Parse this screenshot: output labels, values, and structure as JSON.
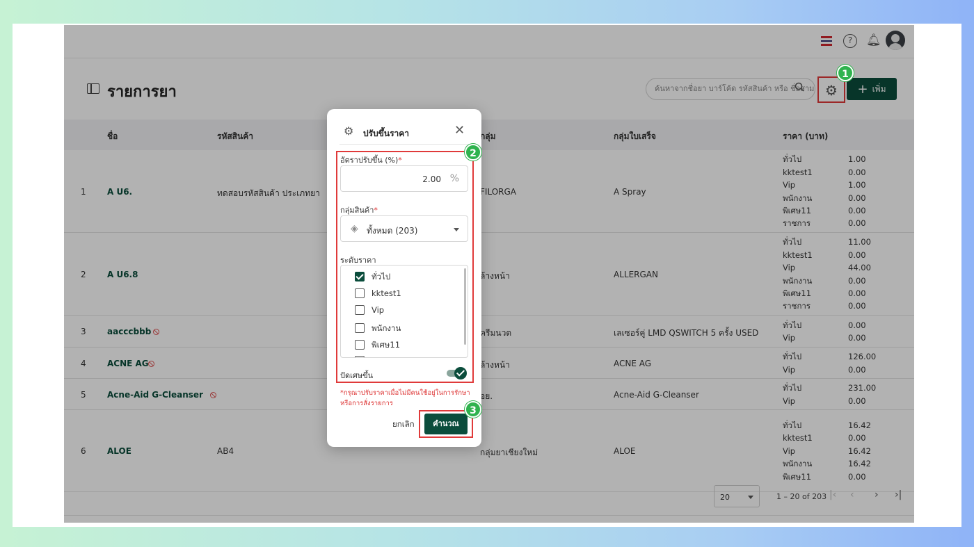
{
  "page": {
    "title": "รายการยา"
  },
  "search": {
    "placeholder": "ค้นหาจากชื่อยา บาร์โค้ด รหัสสินค้า หรือ ชื่อสาม"
  },
  "toolbar": {
    "add_label": "เพิ่ม"
  },
  "table": {
    "headers": {
      "name": "ชื่อ",
      "code": "รหัสสินค้า",
      "group": "กลุ่ม",
      "rx_group": "กลุ่มใบเสร็จ",
      "price": "ราคา (บาท)"
    },
    "rows": [
      {
        "num": "1",
        "name": "A U6.",
        "code": "ทดสอบรหัสสินค้า ประเภทยา",
        "group": "FILORGA",
        "rx": "A Spray",
        "tiers": [
          "ทั่วไป",
          "kktest1",
          "Vip",
          "พนักงาน",
          "พิเศษ11",
          "ราชการ"
        ],
        "prices": [
          "1.00",
          "0.00",
          "1.00",
          "0.00",
          "0.00",
          "0.00"
        ]
      },
      {
        "num": "2",
        "name": "A U6.8",
        "code": "",
        "group": "ล้างหน้า",
        "rx": "ALLERGAN",
        "tiers": [
          "ทั่วไป",
          "kktest1",
          "Vip",
          "พนักงาน",
          "พิเศษ11",
          "ราชการ"
        ],
        "prices": [
          "11.00",
          "0.00",
          "44.00",
          "0.00",
          "0.00",
          "0.00"
        ]
      },
      {
        "num": "3",
        "name": "aacccbbb",
        "code": "",
        "group": "ครีมนวด",
        "rx": "เลเซอร์คู่ LMD QSWITCH 5 ครั้ง USED",
        "tiers": [
          "ทั่วไป",
          "Vip"
        ],
        "prices": [
          "0.00",
          "0.00"
        ]
      },
      {
        "num": "4",
        "name": "ACNE AG",
        "code": "",
        "group": "ล้างหน้า",
        "rx": "ACNE AG",
        "tiers": [
          "ทั่วไป",
          "Vip"
        ],
        "prices": [
          "126.00",
          "0.00"
        ]
      },
      {
        "num": "5",
        "name": "Acne-Aid G-Cleanser",
        "code": "",
        "group": "อย.",
        "rx": "Acne-Aid G-Cleanser",
        "tiers": [
          "ทั่วไป",
          "Vip"
        ],
        "prices": [
          "231.00",
          "0.00"
        ]
      },
      {
        "num": "6",
        "name": "ALOE",
        "code": "AB4",
        "group": "กลุ่มยาเชียงใหม่",
        "rx": "ALOE",
        "tiers": [
          "ทั่วไป",
          "kktest1",
          "Vip",
          "พนักงาน",
          "พิเศษ11"
        ],
        "prices": [
          "16.42",
          "0.00",
          "16.42",
          "16.42",
          "0.00"
        ]
      }
    ]
  },
  "pagination": {
    "page_size": "20",
    "info": "1 – 20 of 203"
  },
  "badges": [
    "1",
    "2",
    "3"
  ],
  "modal": {
    "title": "ปรับขึ้นราคา",
    "rate_label": "อัตราปรับขึ้น (%)",
    "rate_value": "2.00",
    "rate_unit": "%",
    "group_label": "กลุ่มสินค้า",
    "group_value": "ทั้งหมด (203)",
    "tier_label": "ระดับราคา",
    "tiers": [
      {
        "label": "ทั่วไป",
        "checked": true
      },
      {
        "label": "kktest1",
        "checked": false
      },
      {
        "label": "Vip",
        "checked": false
      },
      {
        "label": "พนักงาน",
        "checked": false
      },
      {
        "label": "พิเศษ11",
        "checked": false
      }
    ],
    "rounding_label": "ปัดเศษขึ้น",
    "rounding_on": true,
    "note": "*กรุณาปรับราคาเมื่อไม่มีคนใช้อยู่ในการรักษาหรือการสั่งรายการ",
    "cancel_label": "ยกเลิก",
    "calc_label": "คำนวณ"
  },
  "colors": {
    "primary": "#0b4d3c",
    "highlight": "#e03a3a",
    "badge": "#2fb34e",
    "warning_text": "#dd3333"
  }
}
